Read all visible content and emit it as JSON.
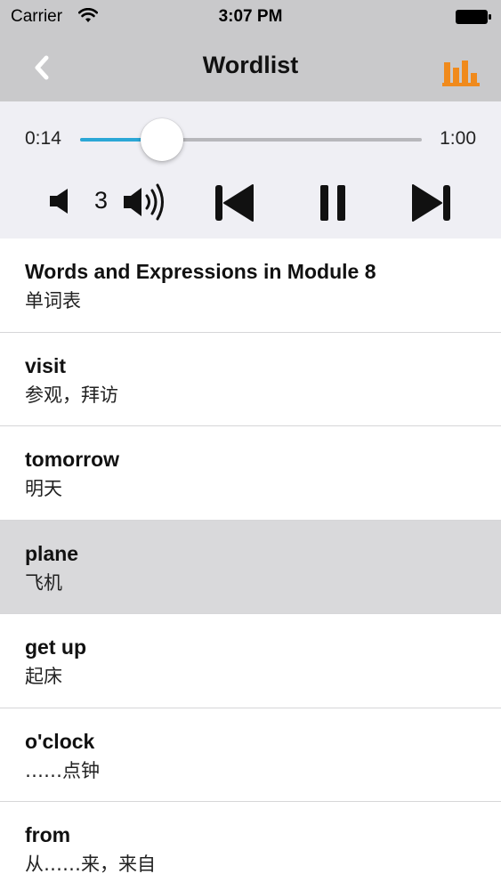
{
  "status_bar": {
    "carrier": "Carrier",
    "time": "3:07 PM"
  },
  "nav": {
    "title": "Wordlist",
    "back_icon": "chevron-left-icon",
    "chart_icon": "bar-chart-icon",
    "accent_color": "#f08a1c"
  },
  "player": {
    "elapsed": "0:14",
    "total": "1:00",
    "progress": 0.24,
    "volume": "3",
    "progress_color": "#2ba7d6"
  },
  "words": [
    {
      "en": "Words and Expressions in Module 8",
      "zh": "单词表",
      "selected": false
    },
    {
      "en": "visit",
      "zh": "参观，拜访",
      "selected": false
    },
    {
      "en": "tomorrow",
      "zh": "明天",
      "selected": false
    },
    {
      "en": "plane",
      "zh": "飞机",
      "selected": true
    },
    {
      "en": "get up",
      "zh": "起床",
      "selected": false
    },
    {
      "en": "o'clock",
      "zh": "……点钟",
      "selected": false
    },
    {
      "en": "from",
      "zh": "从……来，来自",
      "selected": false
    }
  ]
}
